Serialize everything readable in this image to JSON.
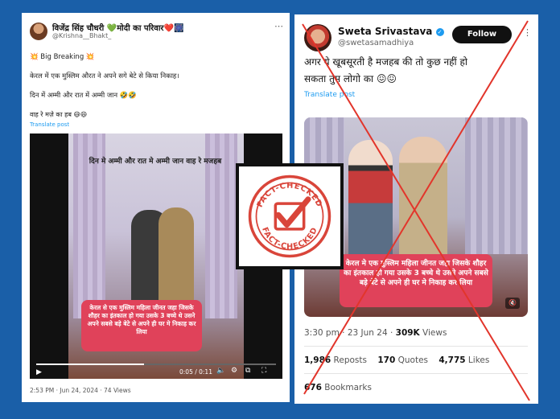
{
  "left_tweet": {
    "author_name": "विजेंद्र सिंह चौधरी 💚मोदी का परिवार❤️🎆",
    "handle": "@Krishna__Bhakt_",
    "lines": [
      "💥 Big Breaking 💥",
      "केरल में एक मुस्लिम औरत ने अपने सगे बेटे से किया निकाह।",
      "दिन में अम्मी और रात में अम्मी जान 🤣🤣",
      "वाह रे मज़े का हब 😄😄"
    ],
    "translate": "Translate post",
    "video": {
      "caption_top": "दिन मे अम्मी और रात मे अम्मी जान वाह रे मजहब",
      "red_caption": "केरल से एक मुस्लिम महिला जीनत जहा जिसके शौहर का इंतकाल हो गया उसके 3 बच्चे थे उसने अपने सबसे बड़े बेटे से अपने ही घर मे निकाह कर लिया",
      "time": "0:05 / 0:11",
      "progress": 0.45
    },
    "meta": "2:53 PM · Jun 24, 2024 · 74 Views"
  },
  "right_tweet": {
    "author_name": "Sweta Srivastava",
    "handle": "@swetasamadhiya",
    "follow_label": "Follow",
    "text_line1": "अगर ये खूबसूरती है मजहब की तो कुछ नहीं हो",
    "text_line2": "सकता तुम लोगो का 😖😖",
    "translate": "Translate post",
    "video": {
      "red_caption": "केरल मे एक मुस्लिम महिला जीनत जहा जिसके शौहर का इंतकाल हो गया उसके 3 बच्चे थे उसने अपने सबसे बड़े बेटे से अपने ही घर मे निकाह कर लिया"
    },
    "time": "3:30 pm · 23 Jun 24 · ",
    "views": "309K",
    "views_label": " Views",
    "reposts": "1,986",
    "reposts_label": " Reposts",
    "quotes": "170",
    "quotes_label": " Quotes",
    "likes": "4,775",
    "likes_label": " Likes",
    "bookmarks": "676",
    "bookmarks_label": " Bookmarks"
  },
  "stamp": {
    "text_top": "FACT-CHECKED",
    "text_bottom": "FACT-CHECKED",
    "color": "#d9453a"
  },
  "colors": {
    "background": "#1a5fa8",
    "cross": "#e2352b",
    "link": "#1d9bf0",
    "caption_box": "#e0425a"
  }
}
